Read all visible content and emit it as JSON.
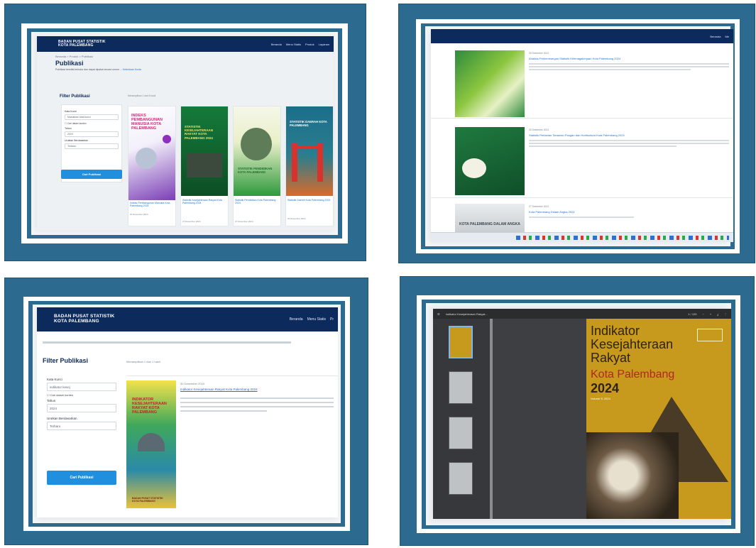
{
  "colors": {
    "frame": "#2c6b8f",
    "navbar": "#0c2a5b",
    "accent": "#1f8fde",
    "link": "#1b74d6",
    "gold": "#c79a1d",
    "red": "#b3261e"
  },
  "site": {
    "brand_line1": "BADAN PUSAT STATISTIK",
    "brand_line2": "KOTA PALEMBANG",
    "menu": [
      "Beranda",
      "Menu Statis",
      "Produk",
      "Layanan"
    ],
    "breadcrumb": "Beranda  >  Produk  >  Publikasi",
    "title": "Publikasi",
    "lead": "Publikasi bersifat terbuka dan dapat dipakai secara umum ...",
    "lead_link": "Ketentuan Kuota",
    "filter_title": "Filter Publikasi",
    "keyword_label": "Kata Kunci",
    "keyword_placeholder": "Masukkan kata kunci",
    "checkbox_label": "Cari dalam konten",
    "year_label": "Tahun",
    "year_value": "2024",
    "sort_label": "Urutkan Berdasarkan",
    "sort_value": "Terbaru",
    "search_button": "Cari Publikasi",
    "result_text": "Menampilkan 1 dari 6 hasil"
  },
  "zoom": {
    "brand_line1": "BADAN PUSAT STATISTIK",
    "brand_line2": "KOTA PALEMBANG",
    "menu": [
      "Beranda",
      "Menu Statis",
      "Pr"
    ],
    "filter_title": "Filter Publikasi",
    "keyword_label": "Kata Kunci",
    "keyword_value": "indikator kesej",
    "checkbox_label": "Cari dalam konten",
    "year_label": "Tahun",
    "year_value": "2024",
    "sort_label": "Urutkan Berdasarkan",
    "sort_value": "Terbaru",
    "search_button": "Cari Publikasi",
    "result_text": "Menampilkan 1 dari 1 hasil",
    "item_date": "30 Desember 2024",
    "item_title": "Indikator Kesejahteraan Rakyat Kota Palembang 2024",
    "cover_text": "INDIKATOR KESEJAHTERAAN RAKYAT KOTA PALEMBANG",
    "cover_bottom": "BADAN PUSAT STATISTIK KOTA PALEMBANG"
  },
  "pub_cards": [
    {
      "cover": "INDEKS PEMBANGUNAN MANUSIA KOTA PALEMBANG",
      "title": "Indeks Pembangunan Manusia Kota Palembang 2024",
      "date": "30 Desember 2024"
    },
    {
      "cover": "STATISTIK KESEJAHTERAAN RAKYAT KOTA PALEMBANG 2024",
      "title": "Statistik Kesejahteraan Rakyat Kota Palembang 2024",
      "date": "27 Desember 2024"
    },
    {
      "cover": "STATISTIK PENDIDIKAN KOTA PALEMBANG",
      "title": "Statistik Pendidikan Kota Palembang 2024",
      "date": "27 Desember 2024"
    },
    {
      "cover": "STATISTIK DAERAH KOTA PALEMBANG",
      "title": "Statistik Daerah Kota Palembang 2024",
      "date": "26 Desember 2024"
    }
  ],
  "list": {
    "menu": [
      "Beranda",
      "Me"
    ],
    "rows": [
      {
        "date": "30 Desember 2024",
        "title": "Analisis Perkembangan Statistik Ketenagakerjaan Kota Palembang 2024"
      },
      {
        "date": "30 Desember 2024",
        "title": "Statistik Pertanian Tanaman Pangan dan Hortikultura Kota Palembang 2024"
      },
      {
        "date": "27 Desember 2024",
        "title": "Kota Palembang Dalam Angka 2024",
        "cover": "KOTA PALEMBANG DALAM ANGKA"
      }
    ]
  },
  "pdf": {
    "filename": "Indikator Kesejahteraan Rakyat...",
    "page_label": "1 / 120",
    "cover_title": "Indikator Kesejahteraan Rakyat",
    "cover_city": "Kota Palembang",
    "cover_year": "2024",
    "cover_volume": "Volume 5, 2024"
  }
}
